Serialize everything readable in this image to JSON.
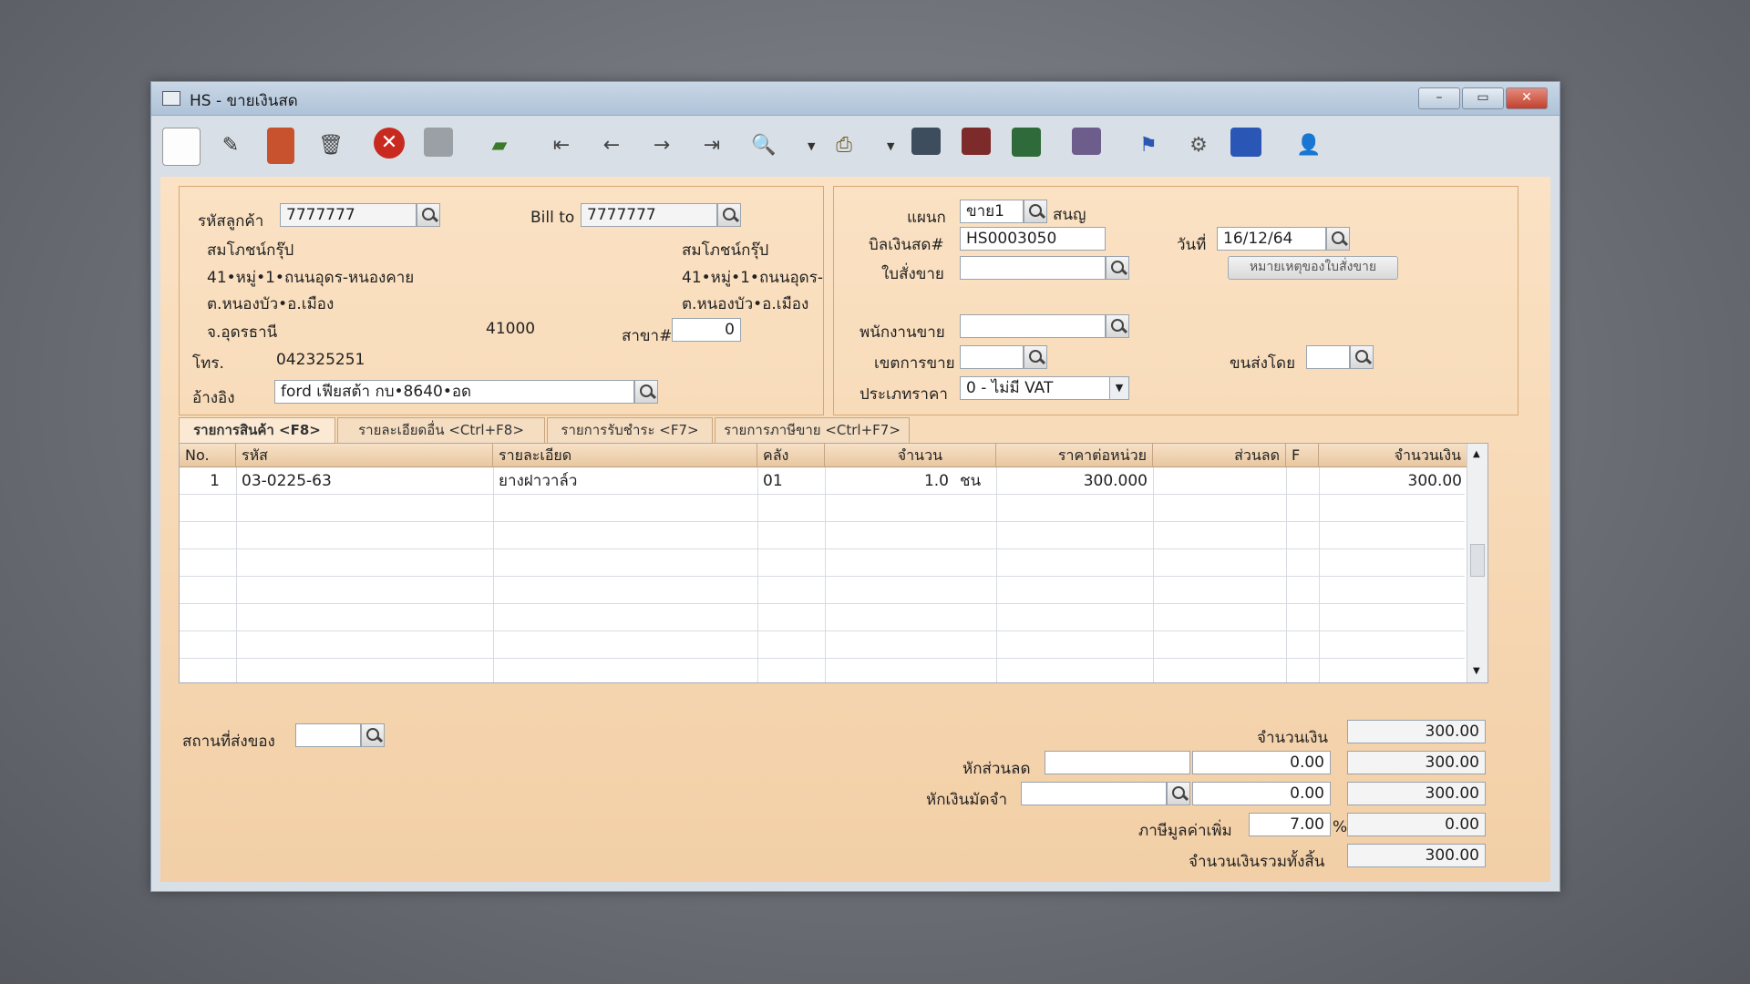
{
  "window": {
    "title": "HS - ขายเงินสด",
    "minimize": "–",
    "maximize": "▭",
    "close": "✕"
  },
  "toolbar": {
    "icons": [
      "new-doc-icon",
      "edit-icon",
      "void-icon",
      "delete-icon",
      "cancel-icon",
      "save-icon",
      "money-icon",
      "first-record-icon",
      "prev-record-icon",
      "next-record-icon",
      "last-record-icon",
      "search-doc-icon",
      "print-icon",
      "report-icon",
      "form-icon",
      "so-icon",
      "receive-icon",
      "approve-icon",
      "tools-icon",
      "ok-icon",
      "user-icon"
    ]
  },
  "customer": {
    "code_label": "รหัสลูกค้า",
    "code": "7777777",
    "billto_label": "Bill to",
    "billto": "7777777",
    "name": "สมโภชน์กรุ๊ป",
    "addr1": "41•หมู่•1•ถนนอุดร-หนองคาย",
    "addr2": "ต.หนองบัว•อ.เมือง",
    "addr3": "จ.อุดรธานี",
    "zip": "41000",
    "bill_name": "สมโภชน์กรุ๊ป",
    "bill_addr1": "41•หมู่•1•ถนนอุดร-",
    "bill_addr2": "ต.หนองบัว•อ.เมือง",
    "branch_label": "สาขา#",
    "branch": "0",
    "phone_label": "โทร.",
    "phone": "042325251",
    "ref_label": "อ้างอิง",
    "ref": "ford เฟียสต้า กบ•8640•อด"
  },
  "doc": {
    "dept_label": "แผนก",
    "dept": "ขาย1",
    "dept_name": "สนญ",
    "bill_label": "บิลเงินสด#",
    "bill": "HS0003050",
    "order_label": "ใบสั่งขาย",
    "order": "",
    "date_label": "วันที่",
    "date": "16/12/64",
    "note_button": "หมายเหตุของใบสั่งขาย",
    "salesperson_label": "พนักงานขาย",
    "salesperson": "",
    "area_label": "เขตการขาย",
    "area": "",
    "ship_label": "ขนส่งโดย",
    "ship": "",
    "price_type_label": "ประเภทราคา",
    "price_type": "0 - ไม่มี VAT"
  },
  "tabs": [
    "รายการสินค้า <F8>",
    "รายละเอียดอื่น <Ctrl+F8>",
    "รายการรับชำระ <F7>",
    "รายการภาษีขาย <Ctrl+F7>"
  ],
  "grid": {
    "headers": [
      "No.",
      "รหัส",
      "รายละเอียด",
      "คลัง",
      "จำนวน",
      "ราคาต่อหน่วย",
      "ส่วนลด",
      "F",
      "จำนวนเงิน"
    ],
    "rows": [
      {
        "no": "1",
        "code": "03-0225-63",
        "desc": "ยางฝาวาล์ว",
        "wh": "01",
        "qty": "1.0",
        "unit": "ชน",
        "price": "300.000",
        "disc": "",
        "f": "",
        "amount": "300.00"
      }
    ]
  },
  "footer": {
    "delivery_label": "สถานที่ส่งของ",
    "delivery": "",
    "amount_label": "จำนวนเงิน",
    "amount": "300.00",
    "discount_label": "หักส่วนลด",
    "discount_text": "",
    "discount": "0.00",
    "after_discount": "300.00",
    "deposit_label": "หักเงินมัดจำ",
    "deposit_text": "",
    "deposit": "0.00",
    "after_deposit": "300.00",
    "vat_label": "ภาษีมูลค่าเพิ่ม",
    "vat_rate": "7.00",
    "vat_pct": "%",
    "vat": "0.00",
    "total_label": "จำนวนเงินรวมทั้งสิ้น",
    "total": "300.00"
  }
}
